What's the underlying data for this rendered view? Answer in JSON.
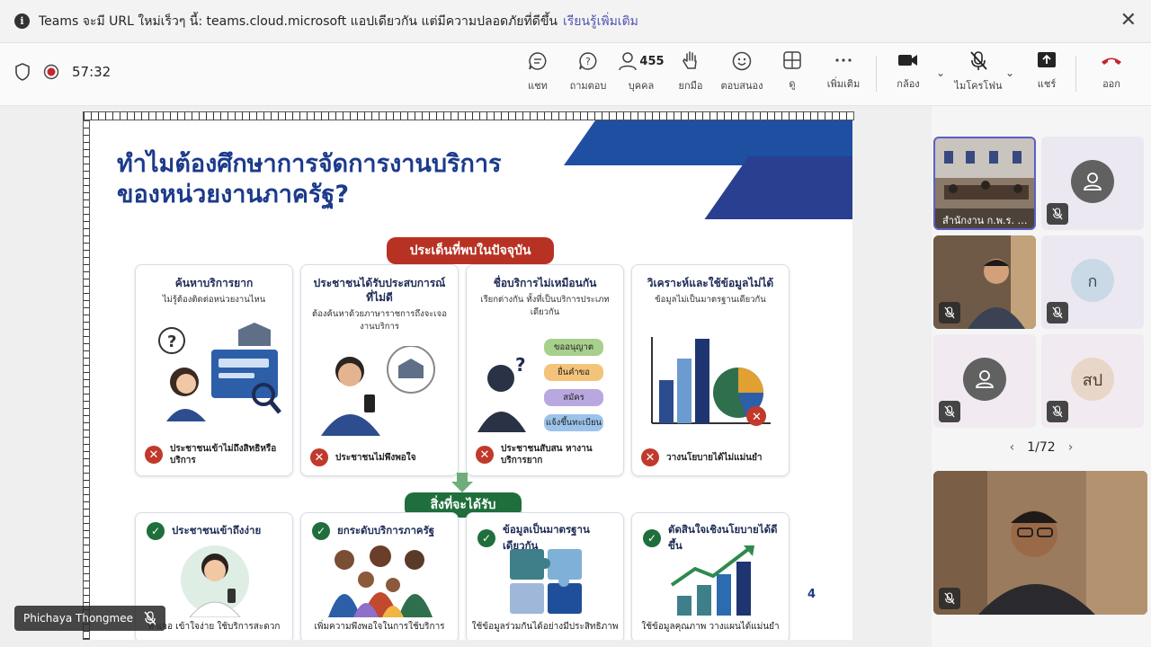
{
  "banner": {
    "message": "Teams จะมี URL ใหม่เร็วๆ นี้: teams.cloud.microsoft แอปเดียวกัน แต่มีความปลอดภัยที่ดีขึ้น",
    "link": "เรียนรู้เพิ่มเติม",
    "close": "✕"
  },
  "toolbar": {
    "timer": "57:32",
    "chat": "แชท",
    "qa": "ถามตอบ",
    "people": "บุคคล",
    "people_count": "455",
    "raise": "ยกมือ",
    "react": "ตอบสนอง",
    "view": "ดู",
    "more": "เพิ่มเติม",
    "camera": "กล้อง",
    "mic": "ไมโครโฟน",
    "share": "แชร์",
    "leave": "ออก"
  },
  "slide": {
    "title_line1": "ทำไมต้องศึกษาการจัดการงานบริการ",
    "title_line2": "ของหน่วยงานภาครัฐ?",
    "issues_pill": "ประเด็นที่พบในปัจจุบัน",
    "benefits_pill": "สิ่งที่จะได้รับ",
    "page_number": "4",
    "issues": [
      {
        "title": "ค้นหาบริการยาก",
        "subtitle": "ไม่รู้ต้องติดต่อหน่วยงานไหน",
        "bottom": "ประชาชนเข้าไม่ถึงสิทธิหรือบริการ"
      },
      {
        "title": "ประชาชนได้รับประสบการณ์ที่ไม่ดี",
        "subtitle": "ต้องค้นหาด้วยภาษาราชการถึงจะเจองานบริการ",
        "bottom": "ประชาชนไม่พึงพอใจ"
      },
      {
        "title": "ชื่อบริการไม่เหมือนกัน",
        "subtitle": "เรียกต่างกัน ทั้งที่เป็นบริการประเภทเดียวกัน",
        "bottom": "ประชาชนสับสน หางานบริการยาก"
      },
      {
        "title": "วิเคราะห์และใช้ข้อมูลไม่ได้",
        "subtitle": "ข้อมูลไม่เป็นมาตรฐานเดียวกัน",
        "bottom": "วางนโยบายได้ไม่แม่นยำ"
      }
    ],
    "tags": [
      "ขออนุญาต",
      "ยื่นคำขอ",
      "สมัคร",
      "แจ้งขึ้นทะเบียน"
    ],
    "benefits": [
      {
        "title": "ประชาชนเข้าถึงง่าย",
        "foot": "หาเจอ เข้าใจง่าย ใช้บริการสะดวก"
      },
      {
        "title": "ยกระดับบริการภาครัฐ",
        "foot": "เพิ่มความพึงพอใจในการใช้บริการ"
      },
      {
        "title": "ข้อมูลเป็นมาตรฐานเดียวกัน",
        "foot": "ใช้ข้อมูลร่วมกันได้อย่างมีประสิทธิภาพ"
      },
      {
        "title": "ตัดสินใจเชิงนโยบายได้ดีขึ้น",
        "foot": "ใช้ข้อมูลคุณภาพ วางแผนได้แม่นยำ"
      }
    ]
  },
  "presenter": {
    "name": "Phichaya Thongmee"
  },
  "participants": {
    "room_caption": "สำนักงาน ก.พ.ร. …",
    "avatar_k": "ก",
    "avatar_sp": "สป",
    "pager": "1/72"
  }
}
